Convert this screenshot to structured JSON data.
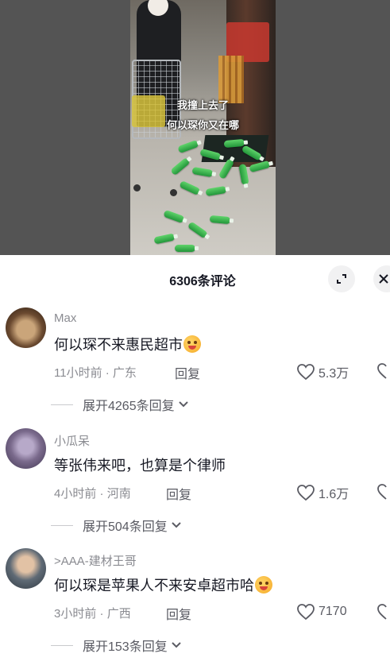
{
  "video": {
    "caption_line1": "我撞上去了",
    "caption_line2": "何以琛你又在哪"
  },
  "comments_panel": {
    "title": "6306条评论",
    "expand_icon": "fullscreen-icon",
    "close_icon": "close-icon"
  },
  "comments": [
    {
      "username": "Max",
      "text": "何以琛不来惠民超市",
      "time": "11小时前",
      "location": "广东",
      "reply_label": "回复",
      "likes": "5.3万",
      "expand_label": "展开4265条回复"
    },
    {
      "username": "小瓜呆",
      "text": "等张伟来吧，也算是个律师",
      "time": "4小时前",
      "location": "河南",
      "reply_label": "回复",
      "likes": "1.6万",
      "expand_label": "展开504条回复"
    },
    {
      "username": ">AAA-建材王哥",
      "text": "何以琛是苹果人不来安卓超市哈",
      "time": "3小时前",
      "location": "广西",
      "reply_label": "回复",
      "likes": "7170",
      "expand_label": "展开153条回复"
    }
  ],
  "colors": {
    "text_primary": "#161823",
    "text_secondary": "#8a8b91",
    "bottle_green": "#2fb04a"
  }
}
